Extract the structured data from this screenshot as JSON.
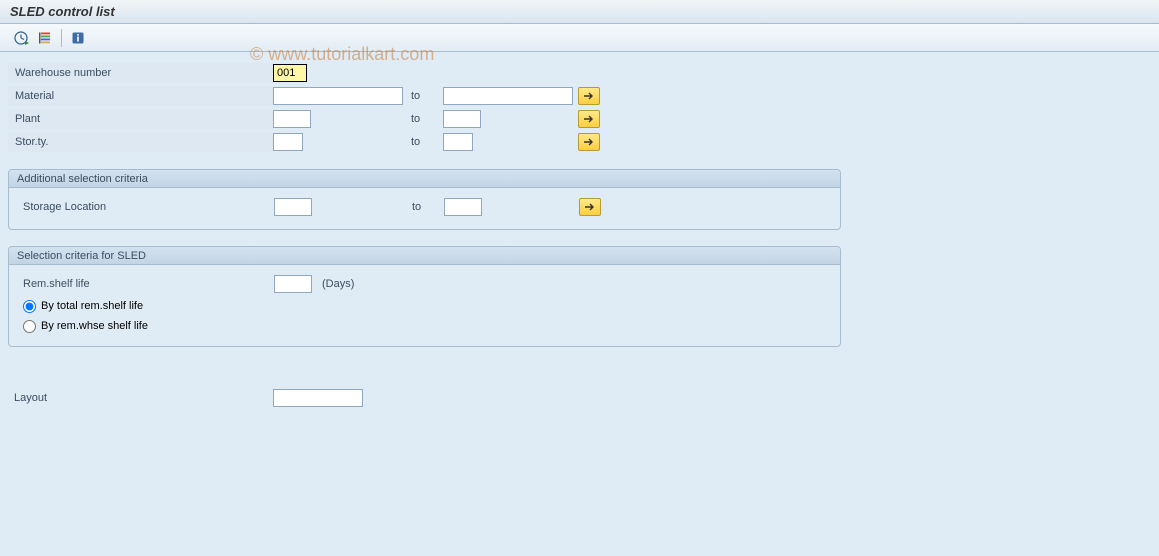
{
  "title": "SLED control list",
  "watermark": "© www.tutorialkart.com",
  "toolbar": {
    "execute_icon": "execute",
    "variant_icon": "variant",
    "info_icon": "info"
  },
  "fields": {
    "warehouse_number": {
      "label": "Warehouse number",
      "value": "001"
    },
    "material": {
      "label": "Material",
      "from": "",
      "to": "",
      "to_label": "to"
    },
    "plant": {
      "label": "Plant",
      "from": "",
      "to": "",
      "to_label": "to"
    },
    "stor_ty": {
      "label": "Stor.ty.",
      "from": "",
      "to": "",
      "to_label": "to"
    }
  },
  "group_additional": {
    "title": "Additional selection criteria",
    "storage_location": {
      "label": "Storage Location",
      "from": "",
      "to": "",
      "to_label": "to"
    }
  },
  "group_sled": {
    "title": "Selection criteria for SLED",
    "rem_shelf_life": {
      "label": "Rem.shelf life",
      "value": "",
      "unit": "(Days)"
    },
    "radio_total": {
      "label": "By total rem.shelf life",
      "checked": true
    },
    "radio_whse": {
      "label": "By rem.whse shelf life",
      "checked": false
    }
  },
  "layout": {
    "label": "Layout",
    "value": ""
  }
}
